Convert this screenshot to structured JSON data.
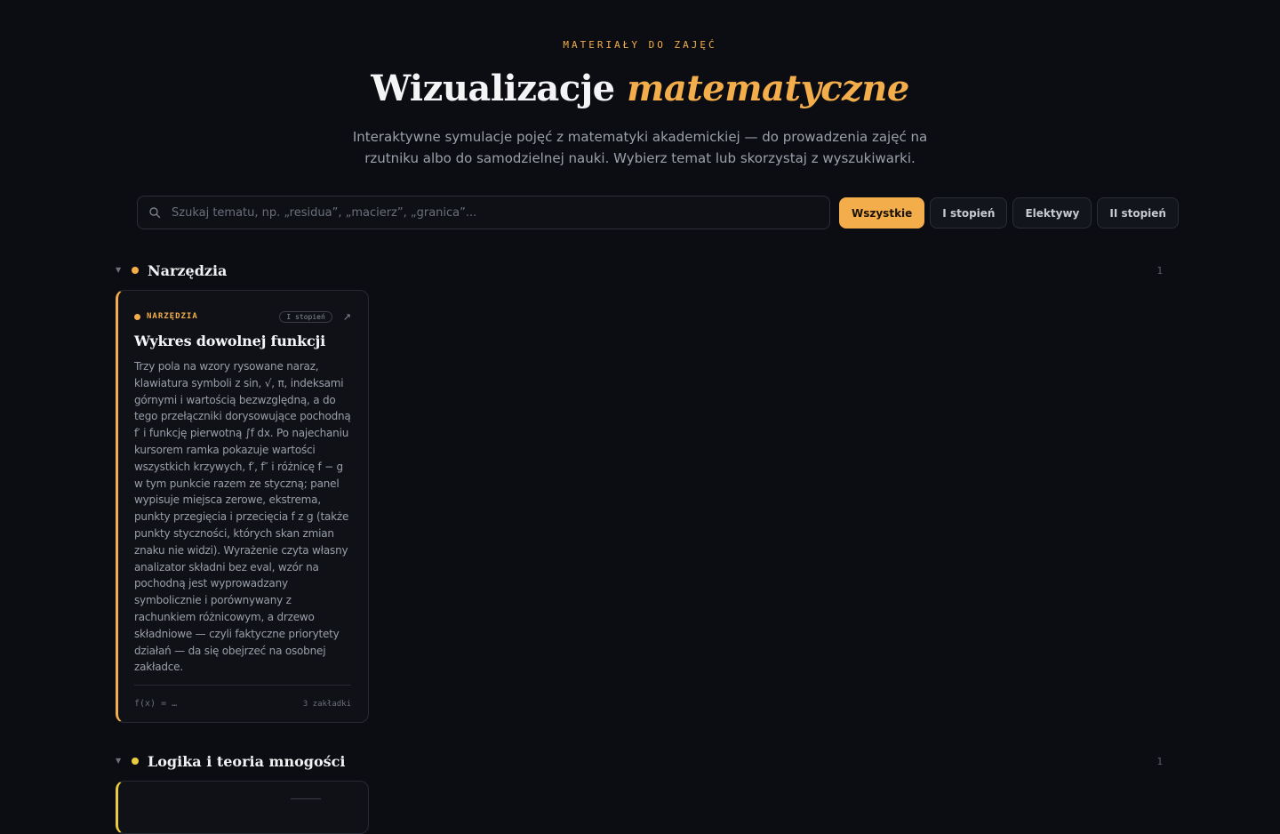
{
  "header": {
    "eyebrow": "MATERIAŁY DO ZAJĘĆ",
    "title_main": "Wizualizacje",
    "title_accent": "matematyczne",
    "subtitle": "Interaktywne symulacje pojęć z matematyki akademickiej — do prowadzenia zajęć na rzutniku albo do samodzielnej nauki. Wybierz temat lub skorzystaj z wyszukiwarki."
  },
  "search": {
    "placeholder": "Szukaj tematu, np. „residua”, „macierz”, „granica”...",
    "value": "",
    "icon": "search-icon"
  },
  "filters": [
    {
      "label": "Wszystkie",
      "active": true
    },
    {
      "label": "I stopień",
      "active": false
    },
    {
      "label": "Elektywy",
      "active": false
    },
    {
      "label": "II stopień",
      "active": false
    }
  ],
  "sections": [
    {
      "title": "Narzędzia",
      "count": "1",
      "dot_color": "#f3ad4b",
      "cards": [
        {
          "category": "NARZĘDZIA",
          "badge": "I stopień",
          "title": "Wykres dowolnej funkcji",
          "description": "Trzy pola na wzory rysowane naraz, klawiatura symboli z sin, √, π, indeksami górnymi i wartością bezwzględną, a do tego przełączniki dorysowujące pochodną f′ i funkcję pierwotną ∫f dx. Po najechaniu kursorem ramka pokazuje wartości wszystkich krzywych, f′, f″ i różnicę f − g w tym punkcie razem ze styczną; panel wypisuje miejsca zerowe, ekstrema, punkty przegięcia i przecięcia f z g (także punkty styczności, których skan zmian znaku nie widzi). Wyrażenie czyta własny analizator składni bez eval, wzór na pochodną jest wyprowadzany symbolicznie i porównywany z rachunkiem różnicowym, a drzewo składniowe — czyli faktyczne priorytety działań — da się obejrzeć na osobnej zakładce.",
          "formula": "f(x) = …",
          "tabs": "3 zakładki"
        }
      ]
    },
    {
      "title": "Logika i teoria mnogości",
      "count": "1",
      "dot_color": "#e8cb3f"
    }
  ]
}
